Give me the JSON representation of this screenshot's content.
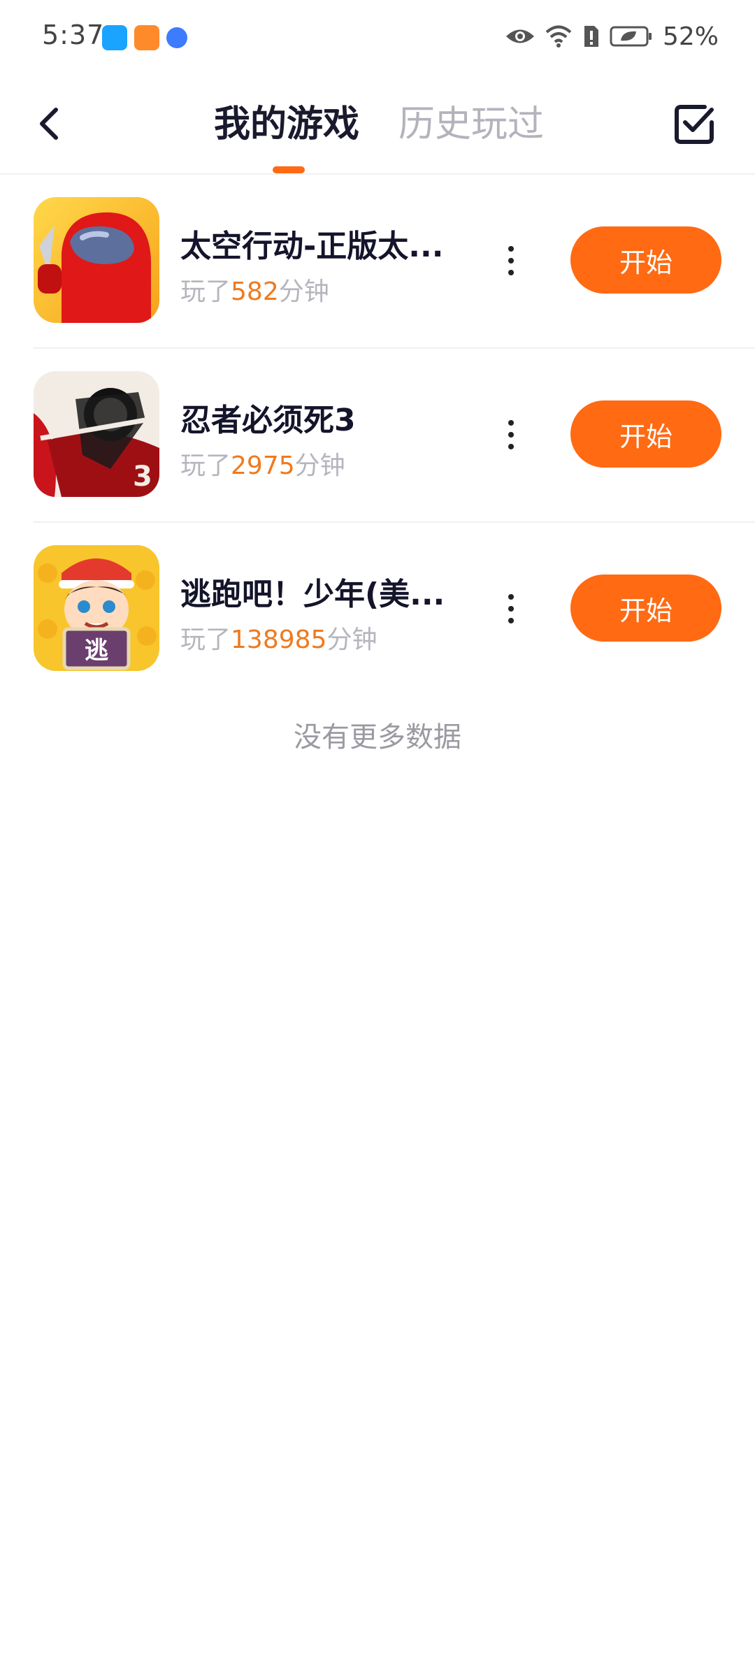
{
  "status_bar": {
    "time": "5:37",
    "battery_percent": "52%",
    "notification_icons": [
      "search-app-icon",
      "video-app-icon",
      "browser-app-icon"
    ],
    "system_icons": [
      "eye-icon",
      "wifi-icon",
      "sim-alert-icon",
      "battery-icon"
    ]
  },
  "header": {
    "tabs": [
      {
        "label": "我的游戏",
        "active": true
      },
      {
        "label": "历史玩过",
        "active": false
      }
    ],
    "accent_color": "#ff6a13"
  },
  "games": [
    {
      "title": "太空行动-正版太...",
      "play_prefix": "玩了",
      "minutes": "582",
      "play_suffix": "分钟",
      "start_label": "开始",
      "icon": "red-astronaut-icon"
    },
    {
      "title": "忍者必须死3",
      "play_prefix": "玩了",
      "minutes": "2975",
      "play_suffix": "分钟",
      "start_label": "开始",
      "icon": "ninja-icon"
    },
    {
      "title": "逃跑吧！少年(美...",
      "play_prefix": "玩了",
      "minutes": "138985",
      "play_suffix": "分钟",
      "start_label": "开始",
      "icon": "boy-escape-icon"
    }
  ],
  "footer": {
    "no_more": "没有更多数据"
  }
}
